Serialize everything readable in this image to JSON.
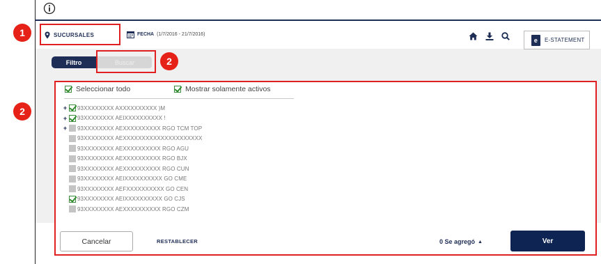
{
  "header": {
    "tab_sucursales": "SUCURSALES",
    "tab_fecha_label": "FECHA",
    "tab_fecha_range": "(1/7/2016 - 21/7/2016)",
    "estatement_label": "E-STATEMENT",
    "estatement_icon_letter": "e",
    "icons": [
      "home-icon",
      "download-icon",
      "search-icon"
    ]
  },
  "filter_tabs": {
    "filtro": "Filtro",
    "buscar": "Buscar"
  },
  "selection": {
    "select_all": "Seleccionar todo",
    "show_active_only": "Mostrar solamente activos",
    "select_all_checked": true,
    "show_active_checked": true
  },
  "branches": [
    {
      "label": "93XXXXXXXX AXXXXXXXXXX )M",
      "expandable": true,
      "checked": true
    },
    {
      "label": "93XXXXXXXX AEIXXXXXXXXXX !",
      "expandable": true,
      "checked": true
    },
    {
      "label": "93XXXXXXXX AEXXXXXXXXXX RGO TCM TOP",
      "expandable": true,
      "checked": false
    },
    {
      "label": "93XXXXXXXX AEXXXXXXXXXXXXXXXXXXXXX",
      "expandable": false,
      "checked": false
    },
    {
      "label": "93XXXXXXXX AEXXXXXXXXXX RGO AGU",
      "expandable": false,
      "checked": false
    },
    {
      "label": "93XXXXXXXX AEXXXXXXXXXX RGO BJX",
      "expandable": false,
      "checked": false
    },
    {
      "label": "93XXXXXXXX AEXXXXXXXXXX RGO CUN",
      "expandable": false,
      "checked": false
    },
    {
      "label": "93XXXXXXXX AEIXXXXXXXXXX GO CME",
      "expandable": false,
      "checked": false
    },
    {
      "label": "93XXXXXXXX AEFXXXXXXXXXX GO CEN",
      "expandable": false,
      "checked": false
    },
    {
      "label": "93XXXXXXXX AEIXXXXXXXXXX GO CJS",
      "expandable": false,
      "checked": true
    },
    {
      "label": "93XXXXXXXX AEXXXXXXXXXX RGO CZM",
      "expandable": false,
      "checked": false
    }
  ],
  "footer": {
    "cancel": "Cancelar",
    "reset": "RESTABLECER",
    "added": "0 Se agregó",
    "added_arrow": "▲",
    "view": "Ver"
  },
  "annotations": {
    "badge_1": "1",
    "badge_2a": "2",
    "badge_2b": "2"
  },
  "colors": {
    "brand_navy": "#1e2d55",
    "check_green": "#2e8b2e",
    "annotation_red": "#e02020"
  }
}
